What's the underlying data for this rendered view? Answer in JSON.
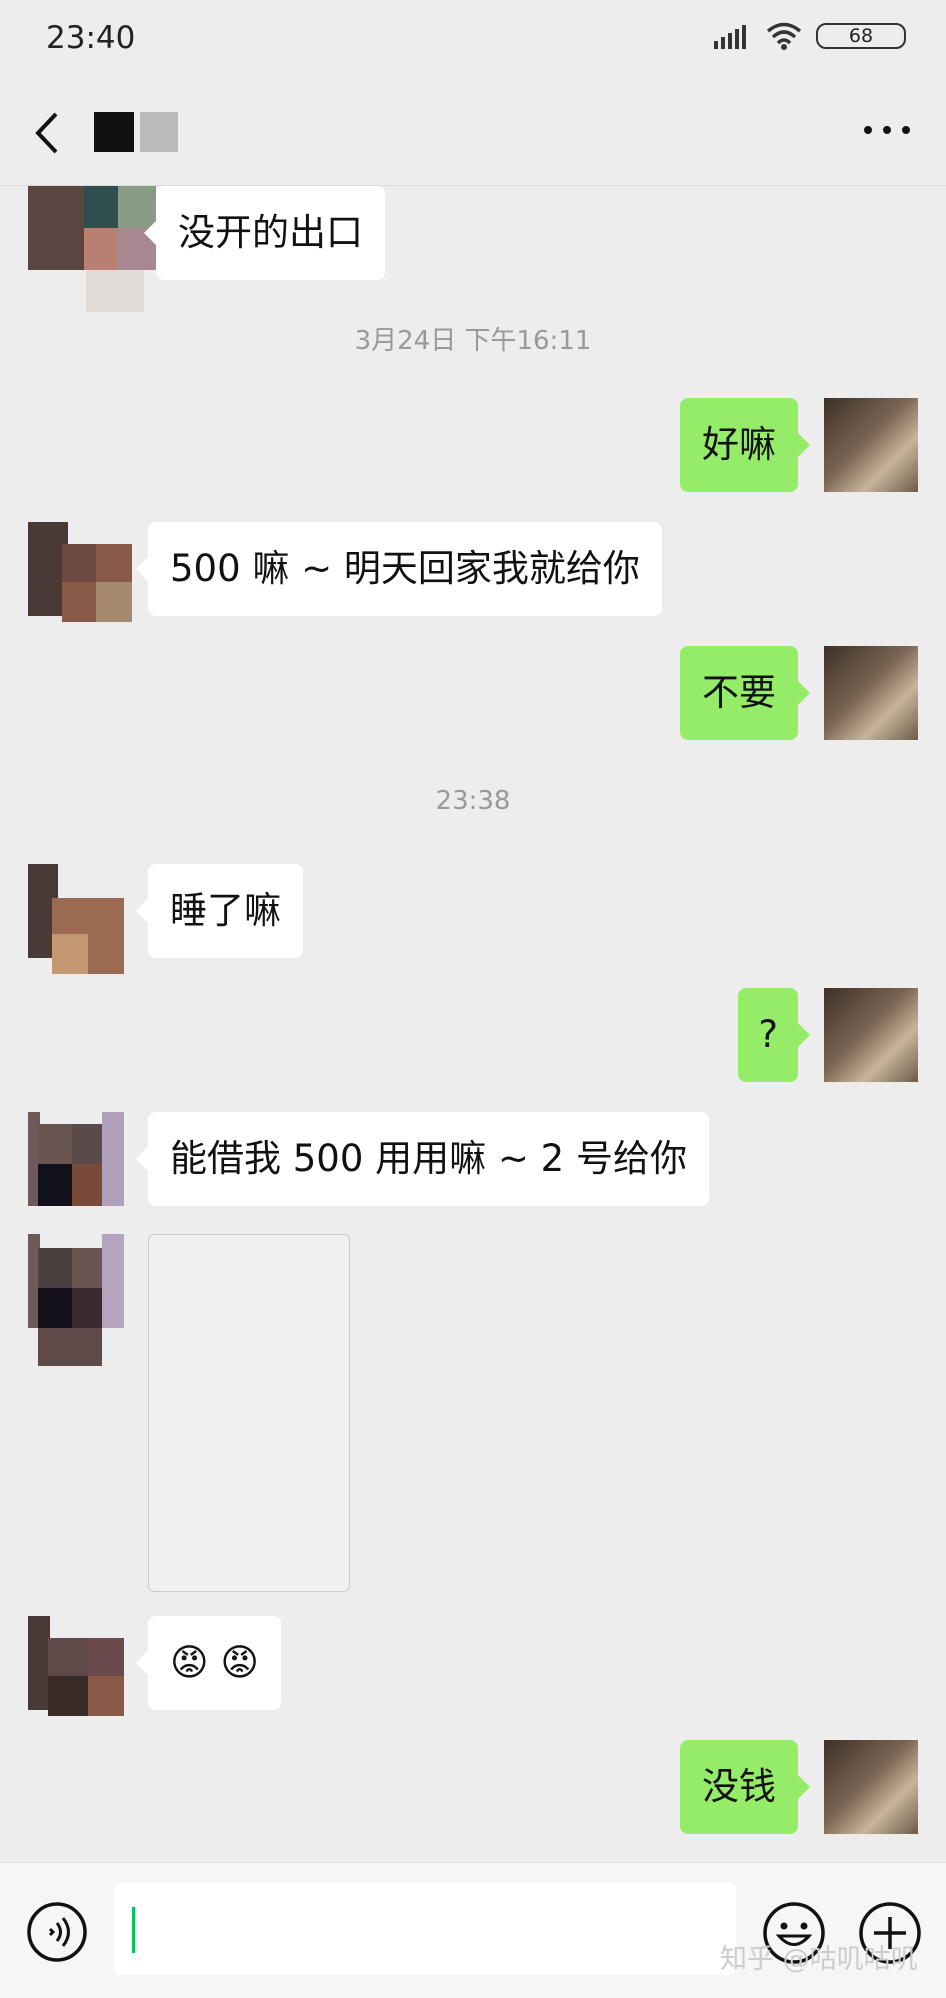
{
  "status": {
    "time": "23:40",
    "battery": "68"
  },
  "header": {
    "title_partial": ""
  },
  "messages": [
    {
      "type": "in",
      "text": "没开的出口"
    },
    {
      "type": "time",
      "text": "3月24日 下午16:11"
    },
    {
      "type": "out",
      "text": "好嘛"
    },
    {
      "type": "in",
      "text": "500 嘛 ~ 明天回家我就给你"
    },
    {
      "type": "out",
      "text": "不要"
    },
    {
      "type": "time",
      "text": "23:38"
    },
    {
      "type": "in",
      "text": "睡了嘛"
    },
    {
      "type": "out",
      "text": "?"
    },
    {
      "type": "in",
      "text": "能借我 500 用用嘛 ~ 2 号给你"
    },
    {
      "type": "in-image",
      "text": ""
    },
    {
      "type": "in",
      "text": "😡 😡"
    },
    {
      "type": "out",
      "text": "没钱"
    }
  ],
  "input": {
    "value": ""
  },
  "watermark": "知乎 @咕叽咕叽",
  "colors": {
    "bg": "#ededed",
    "outgoing": "#95ec69",
    "incoming": "#ffffff",
    "accent": "#07c160"
  },
  "icons": [
    "back-icon",
    "more-icon",
    "voice-icon",
    "emoji-icon",
    "plus-icon",
    "signal-icon",
    "wifi-icon"
  ]
}
